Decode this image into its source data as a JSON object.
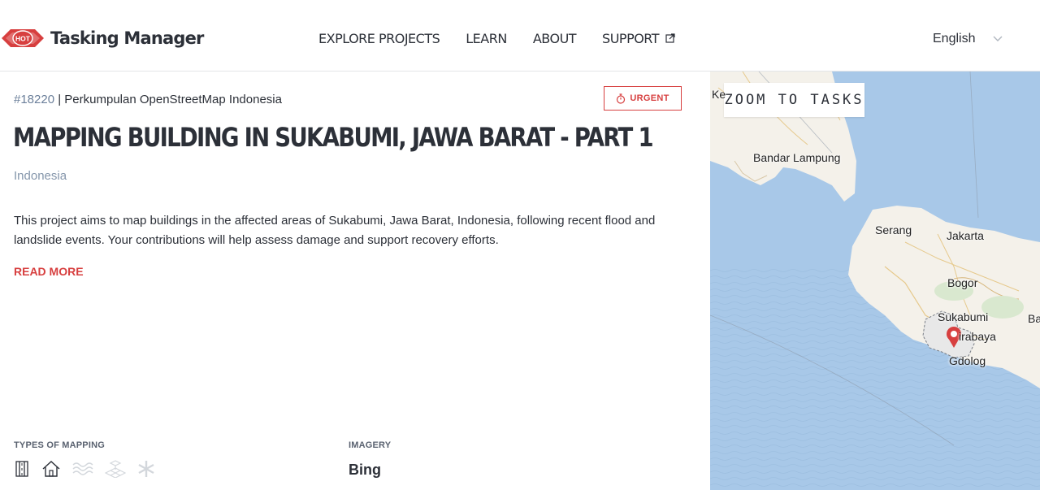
{
  "header": {
    "logo_badge": "HOT",
    "app_name": "Tasking Manager",
    "nav": [
      {
        "label": "EXPLORE PROJECTS"
      },
      {
        "label": "LEARN"
      },
      {
        "label": "ABOUT"
      },
      {
        "label": "SUPPORT"
      }
    ],
    "language": "English"
  },
  "project": {
    "id": "#18220",
    "separator": " | ",
    "organisation": "Perkumpulan OpenStreetMap Indonesia",
    "urgent_label": "URGENT",
    "title": "MAPPING BUILDING IN SUKABUMI, JAWA BARAT - PART 1",
    "country": "Indonesia",
    "description": "This project aims to map buildings in the affected areas of Sukabumi, Jawa Barat, Indonesia, following recent flood and landslide events. Your contributions will help assess damage and support recovery efforts.",
    "read_more": "READ MORE",
    "types_label": "TYPES OF MAPPING",
    "types": [
      {
        "icon": "roads-icon",
        "active": true
      },
      {
        "icon": "buildings-icon",
        "active": true
      },
      {
        "icon": "waterways-icon",
        "active": false
      },
      {
        "icon": "land-use-icon",
        "active": false
      },
      {
        "icon": "other-icon",
        "active": false
      }
    ],
    "imagery_label": "IMAGERY",
    "imagery": "Bing"
  },
  "map": {
    "zoom_button": "ZOOM TO TASKS",
    "labels": {
      "ke": "Ke",
      "bandar_lampung": "Bandar Lampung",
      "serang": "Serang",
      "jakarta": "Jakarta",
      "bogor": "Bogor",
      "sukabumi": "Sukabumi",
      "ba": "Ba",
      "cirabaya": "irabaya",
      "gedolog": "Gdolog"
    }
  },
  "colors": {
    "accent": "#d73f3f",
    "sea": "#a8c8e8",
    "land": "#f4f1ea"
  }
}
